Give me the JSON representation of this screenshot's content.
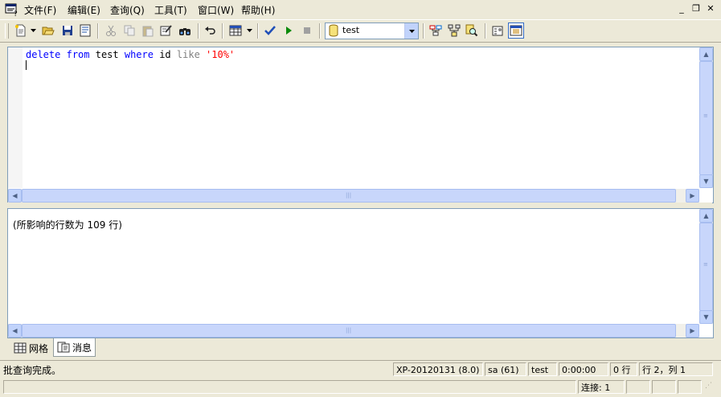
{
  "menu": {
    "items": [
      "文件(F)",
      "编辑(E)",
      "查询(Q)",
      "工具(T)",
      "窗口(W)",
      "帮助(H)"
    ]
  },
  "toolbar": {
    "database_selected": "test",
    "icons": [
      "new-query-icon",
      "dropdown-arrow-icon",
      "open-folder-icon",
      "save-icon",
      "load-script-icon",
      "cut-icon",
      "copy-icon",
      "paste-icon",
      "clear-icon",
      "find-icon",
      "undo-icon",
      "results-mode-icon",
      "dropdown-arrow-icon",
      "parse-check-icon",
      "execute-icon",
      "stop-icon",
      "database-icon",
      "show-plan-icon",
      "index-tuning-icon",
      "object-search-icon",
      "properties-icon",
      "object-browser-icon"
    ]
  },
  "editor": {
    "tokens": [
      {
        "text": "delete",
        "type": "kw"
      },
      {
        "text": " ",
        "type": "plain"
      },
      {
        "text": "from",
        "type": "kw"
      },
      {
        "text": " test ",
        "type": "plain"
      },
      {
        "text": "where",
        "type": "kw"
      },
      {
        "text": " id ",
        "type": "plain"
      },
      {
        "text": "like",
        "type": "op"
      },
      {
        "text": " ",
        "type": "plain"
      },
      {
        "text": "'10%'",
        "type": "str"
      }
    ]
  },
  "results": {
    "message": "(所影响的行数为 109 行)"
  },
  "tabs": [
    {
      "label": "网格",
      "active": false
    },
    {
      "label": "消息",
      "active": true
    }
  ],
  "status": {
    "text": "批查询完成。",
    "server": "XP-20120131 (8.0)",
    "user": "sa (61)",
    "database": "test",
    "elapsed": "0:00:00",
    "rows": "0 行",
    "position": "行 2，列 1",
    "connections": "连接: 1"
  },
  "colors": {
    "keyword": "#0000ff",
    "operator": "#808080",
    "string": "#ff0000",
    "chrome": "#ece9d8"
  }
}
